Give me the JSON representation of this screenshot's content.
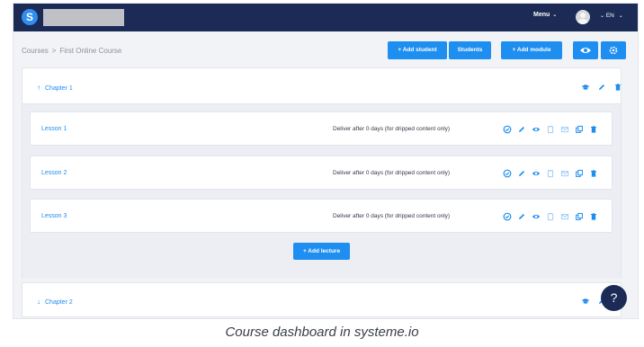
{
  "topbar": {
    "logo_letter": "S",
    "menu_label": "Menu",
    "menu_chevron": "⌄",
    "lang_label": "EN",
    "lang_chevron": "⌄"
  },
  "breadcrumb": {
    "root": "Courses",
    "separator": ">",
    "current": "First Online Course"
  },
  "actions": {
    "add_student": "+ Add student",
    "students": "Students",
    "add_module": "+ Add module",
    "preview_icon": "eye-icon",
    "settings_icon": "gear-icon"
  },
  "chapters": [
    {
      "arrow": "↑",
      "title": "Chapter 1"
    },
    {
      "arrow": "↓",
      "title": "Chapter 2"
    }
  ],
  "chapter_icons": [
    "graduation-cap-icon",
    "pencil-icon",
    "trash-icon"
  ],
  "lessons": [
    {
      "name": "Lesson 1",
      "deliver": "Deliver after 0 days (for dripped content only)"
    },
    {
      "name": "Lesson 2",
      "deliver": "Deliver after 0 days (for dripped content only)"
    },
    {
      "name": "Lesson 3",
      "deliver": "Deliver after 0 days (for dripped content only)"
    }
  ],
  "lesson_icons": [
    "check-circle-icon",
    "pencil-icon",
    "eye-icon",
    "clipboard-icon",
    "envelope-icon",
    "copy-icon",
    "trash-icon"
  ],
  "add_lecture": "+ Add lecture",
  "help_label": "?",
  "caption": "Course dashboard in systeme.io",
  "colors": {
    "navbar": "#1b2b55",
    "accent": "#1f8ef1",
    "background": "#f2f3f7"
  }
}
